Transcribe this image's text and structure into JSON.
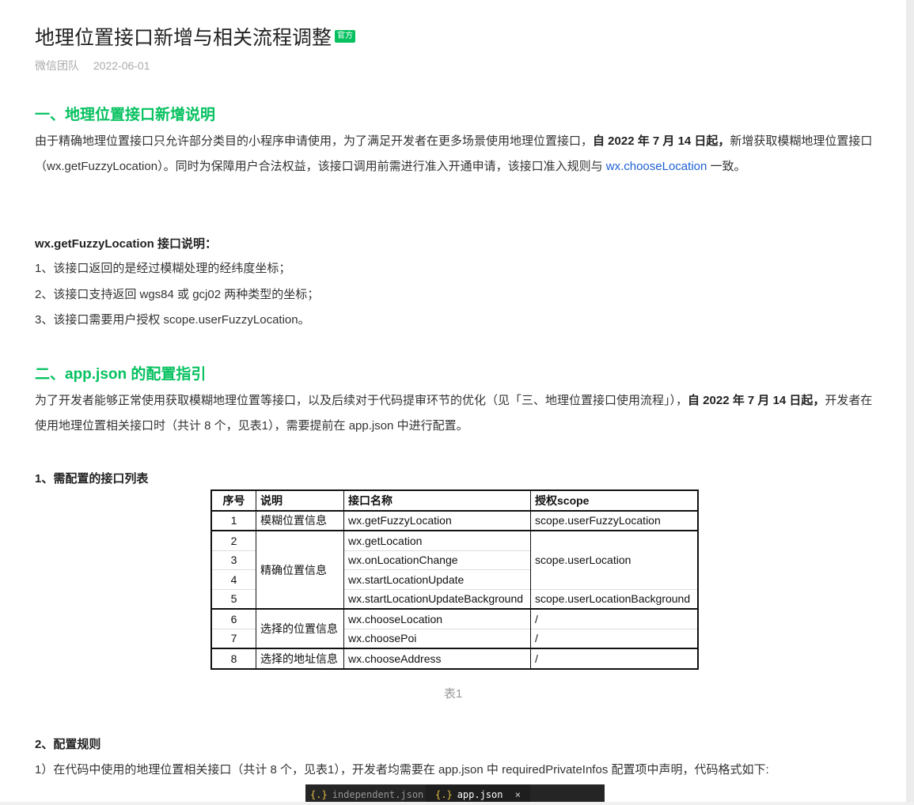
{
  "article": {
    "title": "地理位置接口新增与相关流程调整",
    "badge": "官方",
    "author": "微信团队",
    "date": "2022-06-01"
  },
  "section1": {
    "heading": "一、地理位置接口新增说明",
    "p1_a": "由于精确地理位置接口只允许部分类目的小程序申请使用，为了满足开发者在更多场景使用地理位置接口，",
    "p1_bold": "自 2022 年 7 月 14 日起，",
    "p1_b": "新增获取模糊地理位置接口（wx.getFuzzyLocation）。同时为保障用户合法权益，该接口调用前需进行准入开通申请，该接口准入规则与 ",
    "p1_link": "wx.chooseLocation",
    "p1_c": " 一致。",
    "sub_heading": "wx.getFuzzyLocation 接口说明：",
    "items": [
      "1、该接口返回的是经过模糊处理的经纬度坐标；",
      "2、该接口支持返回 wgs84 或 gcj02 两种类型的坐标；",
      "3、该接口需要用户授权 scope.userFuzzyLocation。"
    ]
  },
  "section2": {
    "heading": "二、app.json 的配置指引",
    "p_a": "为了开发者能够正常使用获取模糊地理位置等接口，以及后续对于代码提审环节的优化（见「三、地理位置接口使用流程」），",
    "p_bold": "自 2022 年 7 月 14 日起，",
    "p_b": "开发者在使用地理位置相关接口时（共计 8 个，见表1），需要提前在 app.json 中进行配置。",
    "sub1": "1、需配置的接口列表",
    "table": {
      "headers": [
        "序号",
        "说明",
        "接口名称",
        "授权scope"
      ],
      "rows": [
        {
          "no": "1",
          "desc": "模糊位置信息",
          "api": "wx.getFuzzyLocation",
          "scope": "scope.userFuzzyLocation"
        },
        {
          "no": "2",
          "desc": "精确位置信息",
          "api": "wx.getLocation",
          "scope": "scope.userLocation"
        },
        {
          "no": "3",
          "api": "wx.onLocationChange"
        },
        {
          "no": "4",
          "api": "wx.startLocationUpdate"
        },
        {
          "no": "5",
          "api": "wx.startLocationUpdateBackground",
          "scope": "scope.userLocationBackground"
        },
        {
          "no": "6",
          "desc": "选择的位置信息",
          "api": "wx.chooseLocation",
          "scope": "/"
        },
        {
          "no": "7",
          "api": "wx.choosePoi",
          "scope": "/"
        },
        {
          "no": "8",
          "desc": "选择的地址信息",
          "api": "wx.chooseAddress",
          "scope": "/"
        }
      ]
    },
    "caption": "表1",
    "sub2": "2、配置规则",
    "rule1": "1）在代码中使用的地理位置相关接口（共计 8 个，见表1），开发者均需要在 app.json 中 requiredPrivateInfos 配置项中声明，代码格式如下:"
  },
  "code_tabs": {
    "brace": "{.}",
    "tab1": "independent.json",
    "tab2": "app.json",
    "close": "×"
  }
}
